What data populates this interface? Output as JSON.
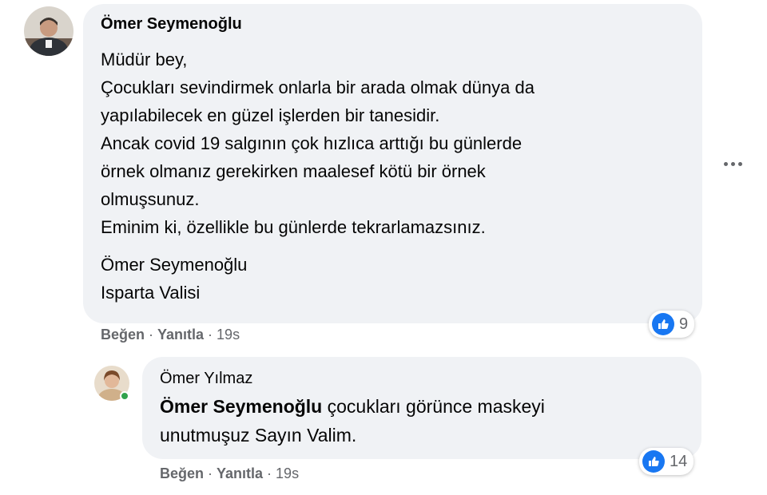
{
  "comment": {
    "author": "Ömer Seymenoğlu",
    "lines": [
      "Müdür bey,",
      "Çocukları sevindirmek onlarla bir arada olmak dünya da",
      "yapılabilecek en güzel işlerden bir tanesidir.",
      "Ancak covid 19 salgının çok hızlıca arttığı bu günlerde",
      "örnek olmanız gerekirken maalesef kötü bir örnek",
      "olmuşsunuz.",
      "Eminim ki, özellikle bu günlerde tekrarlamazsınız."
    ],
    "signature": [
      "Ömer Seymenoğlu",
      "Isparta Valisi"
    ],
    "actions": {
      "like": "Beğen",
      "reply": "Yanıtla",
      "separator": "·",
      "time": "19s"
    },
    "reaction_count": "9",
    "avatar_icon": "profile-photo",
    "more_icon": "more-options-icon"
  },
  "reply": {
    "author": "Ömer Yılmaz",
    "mention": "Ömer Seymenoğlu",
    "text_rest": " çocukları görünce maskeyi",
    "text_line2": "unutmuşuz Sayın Valim.",
    "actions": {
      "like": "Beğen",
      "reply": "Yanıtla",
      "separator": "·",
      "time": "19s"
    },
    "reaction_count": "14",
    "avatar_icon": "profile-photo",
    "online": true
  },
  "colors": {
    "bubble": "#f0f2f5",
    "like_blue": "#1877f2",
    "meta_gray": "#65676b",
    "online_green": "#31a24c"
  }
}
